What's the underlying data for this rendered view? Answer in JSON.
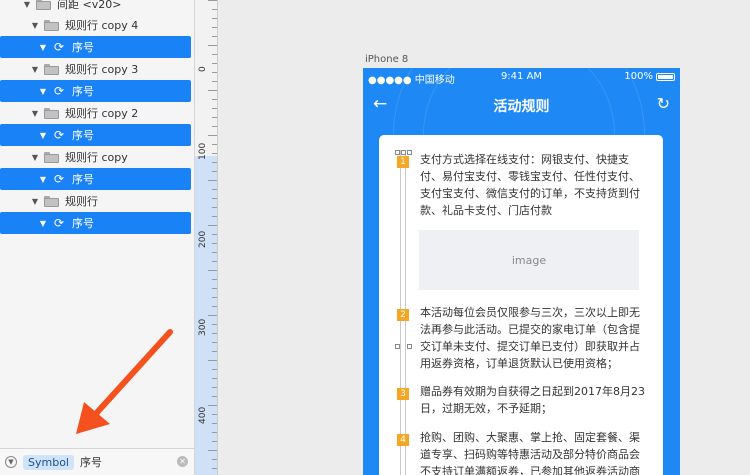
{
  "layers": {
    "rows": [
      {
        "label": "间距 <v20>",
        "type": "group-folder",
        "selected": false
      },
      {
        "label": "规则行 copy 4",
        "type": "folder",
        "selected": false
      },
      {
        "label": "序号",
        "type": "symbol",
        "selected": true
      },
      {
        "label": "规则行 copy 3",
        "type": "folder",
        "selected": false
      },
      {
        "label": "序号",
        "type": "symbol",
        "selected": true
      },
      {
        "label": "规则行 copy 2",
        "type": "folder",
        "selected": false
      },
      {
        "label": "序号",
        "type": "symbol",
        "selected": true
      },
      {
        "label": "规则行 copy",
        "type": "folder",
        "selected": false
      },
      {
        "label": "序号",
        "type": "symbol",
        "selected": true
      },
      {
        "label": "规则行",
        "type": "folder",
        "selected": false
      },
      {
        "label": "序号",
        "type": "symbol",
        "selected": true
      }
    ],
    "selection_color": "#1a82f7"
  },
  "filter": {
    "tag": "Symbol",
    "query": "序号"
  },
  "ruler": {
    "labels": [
      "0",
      "100",
      "200",
      "300",
      "400"
    ]
  },
  "artboard": {
    "label": "iPhone 8"
  },
  "phone": {
    "status": {
      "carrier": "●●●●● 中国移动",
      "time": "9:41 AM",
      "battery": "100%"
    },
    "nav_title": "活动规则",
    "accent_color": "#1e88f5",
    "badge_color": "#f5a623",
    "image_placeholder": "image",
    "rules": [
      {
        "num": "1",
        "text": "支付方式选择在线支付：网银支付、快捷支付、易付宝支付、零钱宝支付、任性付支付、支付宝支付、微信支付的订单，不支持货到付款、礼品卡支付、门店付款"
      },
      {
        "num": "2",
        "text": "本活动每位会员仅限参与三次，三次以上即无法再参与此活动。已提交的家电订单（包含提交订单未支付、提交订单已支付）即获取并占用返券资格，订单退货默认已使用资格；"
      },
      {
        "num": "3",
        "text": "赠品券有效期为自获得之日起到2017年8月23日，过期无效，不予延期；"
      },
      {
        "num": "4",
        "text": "抢购、团购、大聚惠、掌上抢、固定套餐、渠道专享、扫码购等特惠活动及部分特价商品会不支持订单满额返券，已参加其他返券活动商"
      }
    ]
  }
}
